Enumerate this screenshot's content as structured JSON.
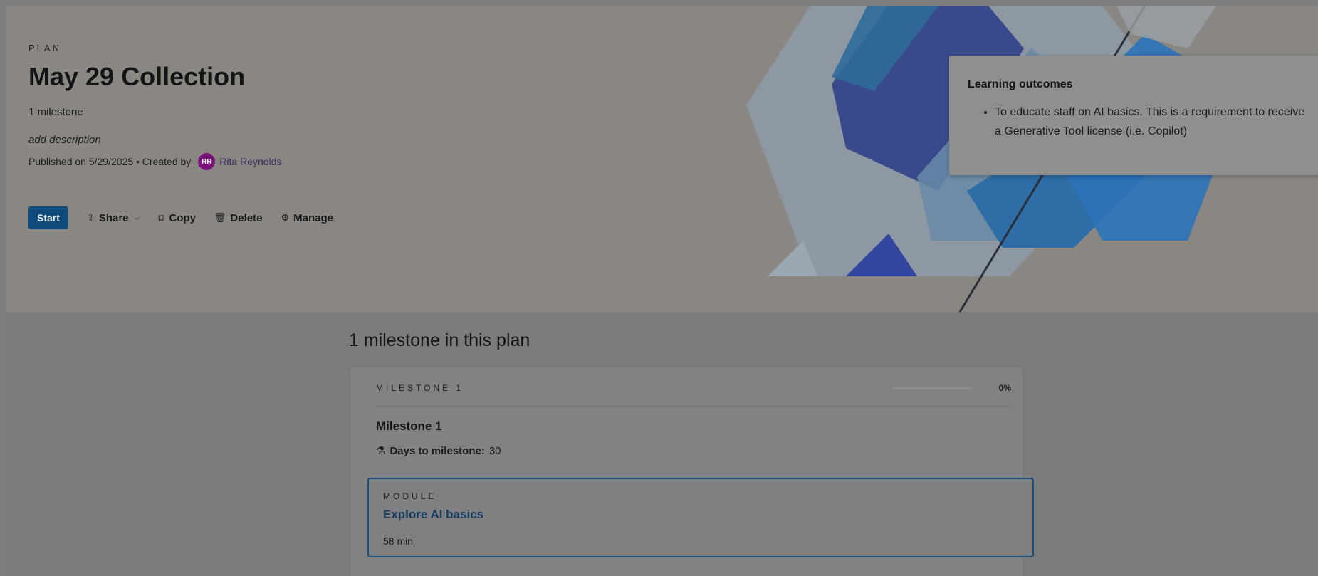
{
  "plan": {
    "eyebrow": "PLAN",
    "title": "May 29 Collection",
    "milestone_count": "1 milestone",
    "description_placeholder": "add description",
    "published_text": "Published on 5/29/2025 • Created by",
    "author_initials": "RR",
    "author_name": "Rita Reynolds",
    "avatar_color": "#7a137a"
  },
  "actions": {
    "start": "Start",
    "share": "Share",
    "copy": "Copy",
    "delete": "Delete",
    "manage": "Manage"
  },
  "outcomes": {
    "title": "Learning outcomes",
    "items": [
      "To educate staff on AI basics. This is a requirement to receive a Generative Tool license (i.e. Copilot)"
    ]
  },
  "milestones_section": {
    "title": "1 milestone in this plan",
    "milestones": [
      {
        "label": "MILESTONE 1",
        "progress_label": "0%",
        "progress_fraction": 0,
        "name": "Milestone 1",
        "days_label": "Days to milestone:",
        "days_value": "30",
        "modules": [
          {
            "label": "MODULE",
            "title": "Explore AI basics",
            "duration": "58 min"
          }
        ]
      }
    ]
  },
  "colors": {
    "accent": "#0e4a7a",
    "overlay_dim": "#7b7b7b"
  }
}
